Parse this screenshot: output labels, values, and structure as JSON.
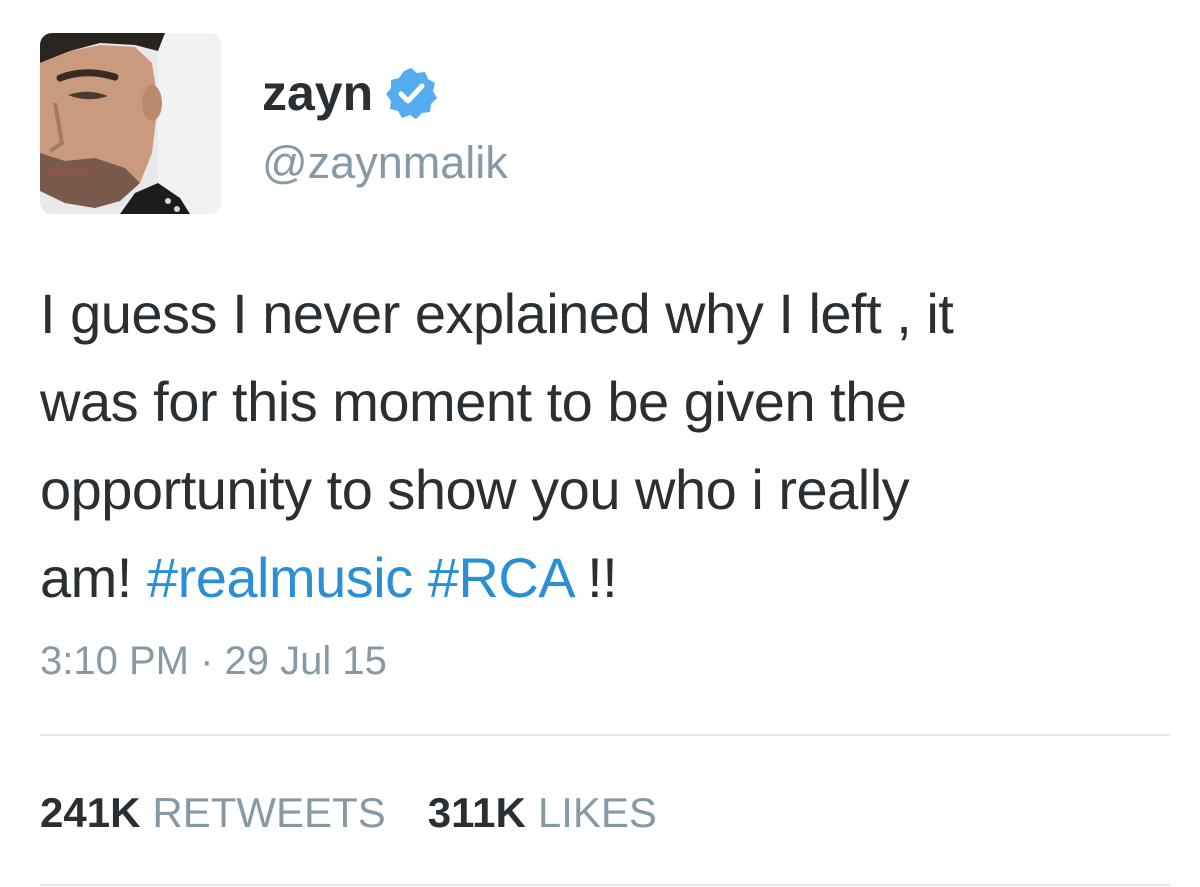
{
  "user": {
    "display_name": "zayn",
    "handle": "@zaynmalik",
    "avatar_icon": "profile-photo-avatar",
    "verified_icon": "verified-badge-icon"
  },
  "tweet": {
    "text_line_1": "I guess I never explained why I left , it",
    "text_line_2": "was for this moment to be given the",
    "text_line_3": "opportunity to show you who i really",
    "text_line_4_prefix": "am!",
    "hashtag_1": "#realmusic",
    "hashtag_2": "#RCA",
    "text_line_4_suffix": "!!",
    "timestamp": "3:10 PM · 29 Jul 15"
  },
  "stats": {
    "retweets_count": "241K",
    "retweets_label": "RETWEETS",
    "likes_count": "311K",
    "likes_label": "LIKES"
  },
  "colors": {
    "text": "#292f33",
    "secondary": "#8899a6",
    "hashtag": "#2b8fd6",
    "verified": "#55acee",
    "divider": "#e1e8ed"
  }
}
